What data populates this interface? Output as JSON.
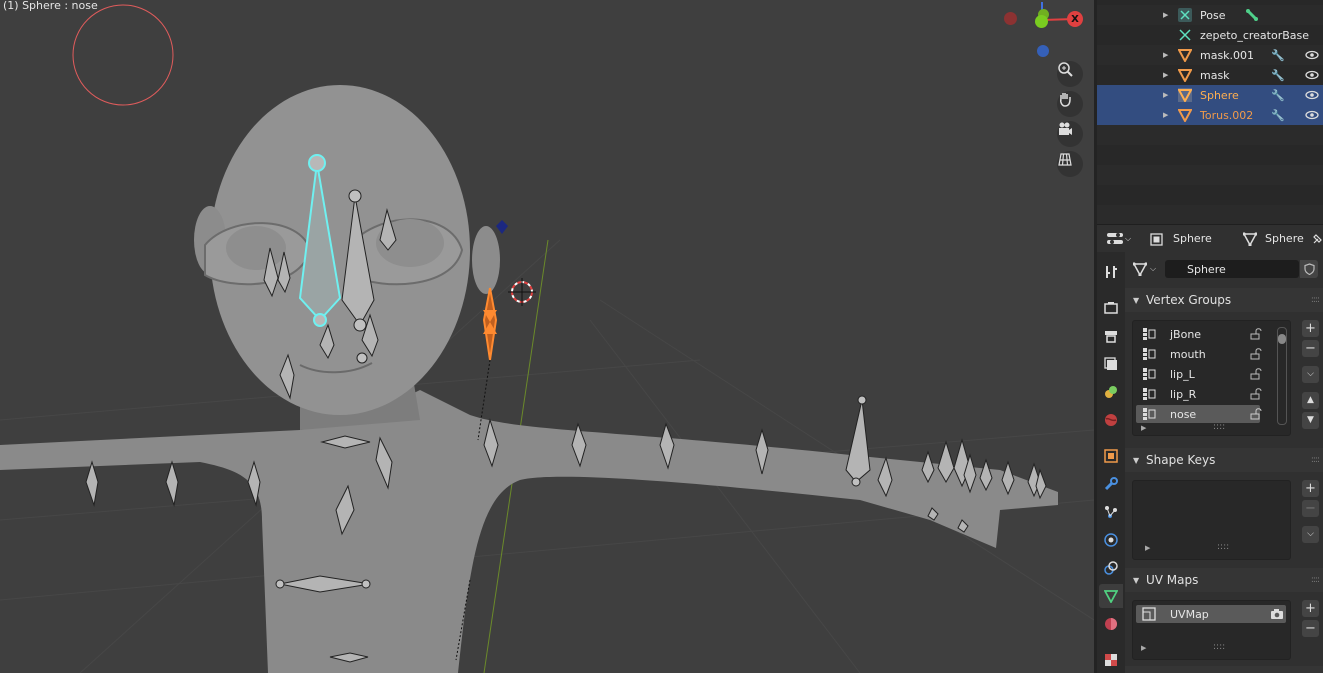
{
  "viewport": {
    "label": "(1) Sphere : nose",
    "gizmo_x_label": "X"
  },
  "outliner": {
    "rows": [
      {
        "name": "Pose",
        "icon": "pose-icon",
        "style": "normal"
      },
      {
        "name": "zepeto_creatorBase",
        "icon": "armature-data-icon",
        "style": "normal"
      },
      {
        "name": "mask.001",
        "icon": "mesh-icon",
        "style": "normal"
      },
      {
        "name": "mask",
        "icon": "mesh-icon",
        "style": "normal"
      },
      {
        "name": "Sphere",
        "icon": "mesh-icon",
        "style": "active"
      },
      {
        "name": "Torus.002",
        "icon": "mesh-icon",
        "style": "selected"
      }
    ]
  },
  "properties": {
    "breadcrumb_object": "Sphere",
    "breadcrumb_data": "Sphere",
    "mesh_name": "Sphere",
    "vertex_groups": {
      "title": "Vertex Groups",
      "items": [
        "jBone",
        "mouth",
        "lip_L",
        "lip_R",
        "nose"
      ],
      "selected": "nose"
    },
    "shape_keys": {
      "title": "Shape Keys"
    },
    "uv_maps": {
      "title": "UV Maps",
      "items": [
        "UVMap"
      ]
    }
  },
  "colors": {
    "selection_blue": "#334d80",
    "active_orange": "#ffaf50",
    "bone_cyan": "#5fe0e0"
  }
}
